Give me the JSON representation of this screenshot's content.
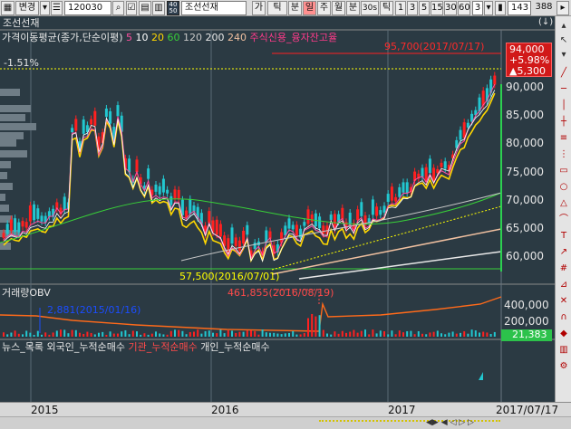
{
  "toolbar": {
    "stock_label": "변경",
    "code": "120030",
    "mode": "40\n50",
    "stock_name": "조선선재",
    "buttons": [
      "가",
      "틱",
      "분",
      "일",
      "주",
      "월",
      "분",
      "30s",
      "틱"
    ],
    "periods": [
      "1",
      "3",
      "5",
      "15",
      "30",
      "60",
      "3"
    ],
    "count": "143",
    "total": "388"
  },
  "chart_title": "조선선재",
  "legend": {
    "price_label": "가격이동평균(종가,단순이평)",
    "ma_items": [
      {
        "label": "5",
        "color": "#ff4fa0"
      },
      {
        "label": "10",
        "color": "#ffffff"
      },
      {
        "label": "20",
        "color": "#ffd700"
      },
      {
        "label": "60",
        "color": "#38d038"
      },
      {
        "label": "120",
        "color": "#c8c8c8"
      },
      {
        "label": "200",
        "color": "#e8e8e8"
      },
      {
        "label": "240",
        "color": "#f0c0a0"
      }
    ],
    "credit_label": "주식신용_융자잔고율"
  },
  "pct_label": "-1.51%",
  "annotations": {
    "high": "95,700(2017/07/17)",
    "low": "57,500(2016/07/01)",
    "obv_high": "461,855(2016/08/19)",
    "obv_low": "2,881(2015/01/16)"
  },
  "price_box": {
    "price": "94,000",
    "change_pct": "+5.98%",
    "change": "▲5,300"
  },
  "y_axis_price": [
    "90,000",
    "85,000",
    "80,000",
    "75,000",
    "70,000",
    "65,000",
    "60,000"
  ],
  "volume_panel": {
    "label": "거래량",
    "obv_label": "OBV",
    "y_axis": [
      "400,000",
      "200,000"
    ],
    "current": "21,383"
  },
  "flow_panel": {
    "labels": [
      "뉴스_목록",
      "외국인_누적순매수",
      "기관_누적순매수",
      "개인_누적순매수"
    ]
  },
  "x_axis": {
    "labels": [
      "2015",
      "2016",
      "2017"
    ],
    "date": "2017/07/17"
  },
  "colors": {
    "background": "#2b3a43",
    "up": "#ff2020",
    "down": "#22c7d0",
    "accent": "#ffff00"
  }
}
